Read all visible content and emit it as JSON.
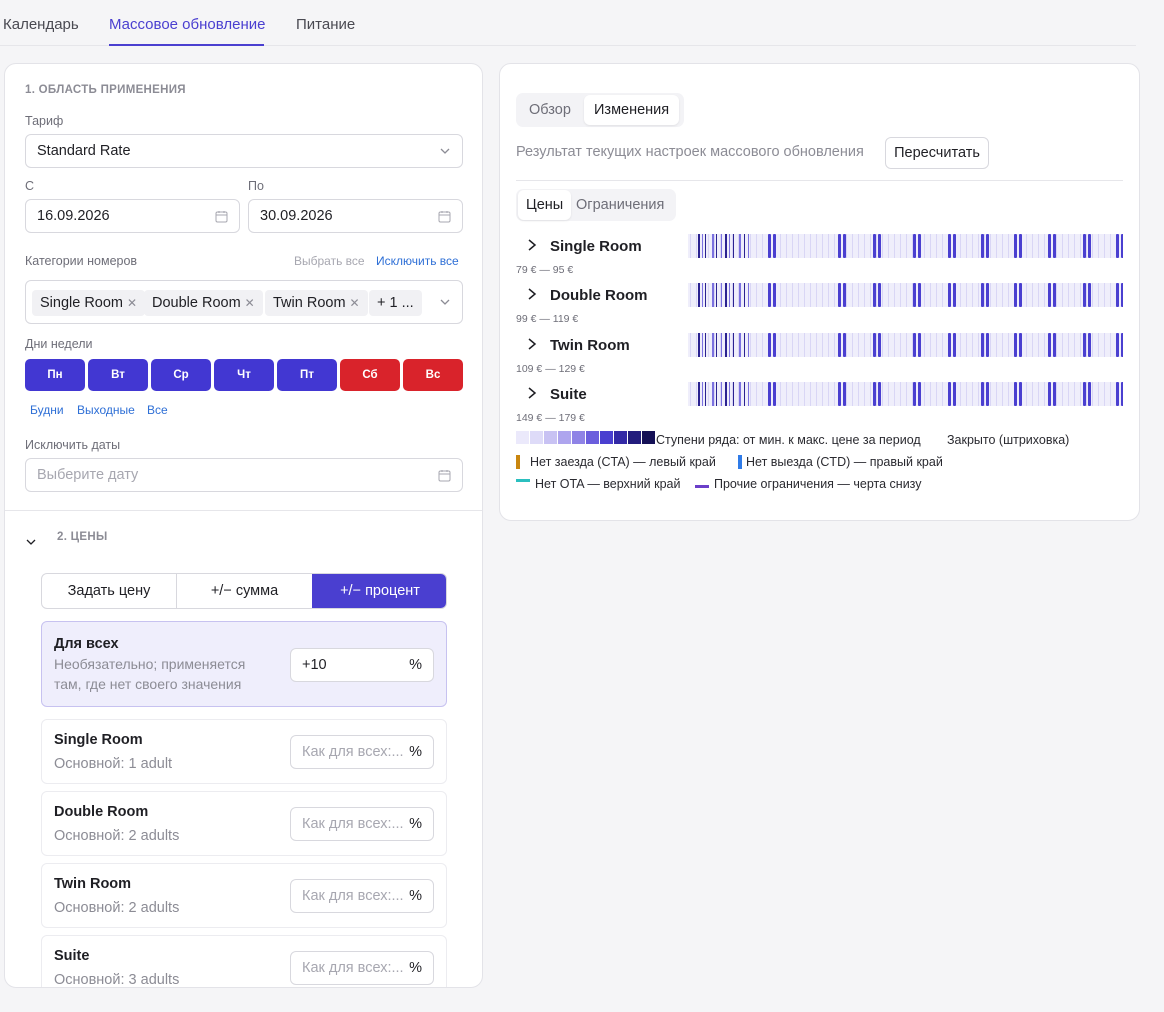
{
  "top_tabs": [
    "Календарь",
    "Массовое обновление",
    "Питание"
  ],
  "scope": {
    "section_title": "1. ОБЛАСТЬ ПРИМЕНЕНИЯ",
    "rate_label": "Тариф",
    "rate_value": "Standard Rate",
    "from_label": "С",
    "from_value": "16.09.2026",
    "to_label": "По",
    "to_value": "30.09.2026",
    "rooms_label": "Категории номеров",
    "select_all": "Выбрать все",
    "exclude_all": "Исключить все",
    "room_chips": [
      "Single Room",
      "Double Room",
      "Twin Room"
    ],
    "more_chip": "+ 1 ...",
    "weekdays_label": "Дни недели",
    "weekdays": [
      "Пн",
      "Вт",
      "Ср",
      "Чт",
      "Пт",
      "Сб",
      "Вс"
    ],
    "quick": [
      "Будни",
      "Выходные",
      "Все"
    ],
    "exclude_label": "Исключить даты",
    "exclude_placeholder": "Выберите дату"
  },
  "prices": {
    "section_title": "2. ЦЕНЫ",
    "modes": [
      "Задать цену",
      "+/− сумма",
      "+/− процент"
    ],
    "active_mode": "+/− процент",
    "all": {
      "title": "Для всех",
      "hint_1": "Необязательно; применяется",
      "hint_2": "там, где нет своего значения",
      "value": "+10",
      "unit": "%"
    },
    "placeholder": "Как для всех:...",
    "rows": [
      {
        "name": "Single Room",
        "base": "Основной: 1 adult"
      },
      {
        "name": "Double Room",
        "base": "Основной: 2 adults"
      },
      {
        "name": "Twin Room",
        "base": "Основной: 2 adults"
      },
      {
        "name": "Suite",
        "base": "Основной: 3 adults"
      }
    ]
  },
  "preview": {
    "tabs": [
      "Обзор",
      "Изменения"
    ],
    "active_tab": "Изменения",
    "result_text": "Результат текущих настроек массового обновления",
    "recalc": "Пересчитать",
    "subtabs": [
      "Цены",
      "Ограничения"
    ],
    "active_subtab": "Цены",
    "rooms": [
      {
        "name": "Single Room",
        "range": "79 € — 95 €"
      },
      {
        "name": "Double Room",
        "range": "99 € — 119 €"
      },
      {
        "name": "Twin Room",
        "range": "109 € — 129 €"
      },
      {
        "name": "Suite",
        "range": "149 € — 179 €"
      }
    ],
    "legend": {
      "steps": "Ступени ряда: от мин. к макс. цене за период",
      "closed": "Закрыто (штриховка)",
      "cta": "Нет заезда (CTA) — левый край",
      "ctd": "Нет выезда (CTD) — правый край",
      "ota": "Нет OTA — верхний край",
      "other": "Прочие ограничения — черта снизу"
    },
    "colors": {
      "accent": "#4a3fd0",
      "weekend": "#d9232b",
      "cta": "#c9860f",
      "ctd": "#2f7be8",
      "ota": "#2bbfbf",
      "other": "#6b3fc9"
    }
  }
}
